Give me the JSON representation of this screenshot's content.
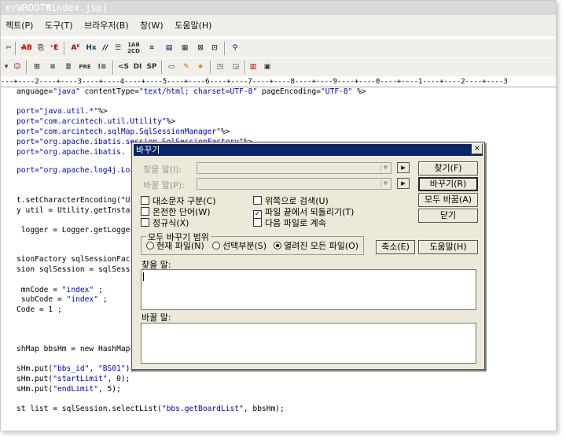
{
  "window": {
    "title": "erWROOT₩index.jsp]"
  },
  "menu": [
    "젝트(P)",
    "도구(T)",
    "브라우저(B)",
    "창(W)",
    "도움말(H)"
  ],
  "toolbar1": [
    "✂",
    "A̶B",
    "⎘",
    "⁺E",
    "A⁶",
    "Hx",
    "//",
    "☰",
    "1AB 2CD",
    "⌗",
    "▤",
    "▦",
    "⊠",
    "⊡",
    "⚲"
  ],
  "toolbar2": [
    "▾",
    "☺",
    "⊞",
    "≡",
    "≣",
    "PRE",
    "⁝≡",
    "<S",
    "DI",
    "SP",
    "▭",
    "✎",
    "★",
    "◳",
    "◲",
    "▥",
    "▣"
  ],
  "ruler": "---+----2----+----3----+----4----+----5----+----6----+----7----+----8----+----9----+----0----+----1----+----2----+----3",
  "code": {
    "l1": {
      "pre": "anguage=",
      "s1": "\"java\"",
      "m1": " contentType=",
      "s2": "\"text/html; charset=UTF-8\"",
      "m2": " pageEncoding=",
      "s3": "\"UTF-8\"",
      "end": " %>"
    },
    "l2": {
      "pre": "port=",
      "s": "\"java.util.*\"",
      "end": "%>"
    },
    "l3": {
      "pre": "port=",
      "s": "\"com.arcintech.util.Utility\"",
      "end": "%>"
    },
    "l4": {
      "pre": "port=",
      "s": "\"com.arcintech.sqlMap.SqlSessionManager\"",
      "end": "%>"
    },
    "l5": {
      "pre": "port=",
      "s": "\"org.apache.ibatis.session.SqlSessionFactory\"",
      "end": "%>"
    },
    "l6": {
      "pre": "port=",
      "s": "\"org.apache.ibatis.",
      "end": ""
    },
    "l7": {
      "pre": "port=",
      "s": "\"org.apache.log4j.Lo",
      "end": ""
    },
    "l8": "t.setCharacterEncoding(\"U",
    "l9": "y util = Utility.getInsta",
    "l10": " logger = Logger.getLogge",
    "l11": "sionFactory sqlSessionFac",
    "l12": "sion sqlSession = sqlSess",
    "l13": {
      "pre": " mnCode = ",
      "s": "\"index\"",
      "end": " ;"
    },
    "l14": {
      "pre": " subCode = ",
      "s": "\"index\"",
      "end": " ;"
    },
    "l15": "Code = 1 ;",
    "l16": "shMap bbsHm = new HashMap",
    "l17": {
      "pre": "sHm.put(",
      "s1": "\"bbs_id\"",
      "m": ", ",
      "s2": "\"BS01\"",
      "end": ");"
    },
    "l18": {
      "pre": "sHm.put(",
      "s1": "\"startLimit\"",
      "end": ", 0);"
    },
    "l19": {
      "pre": "sHm.put(",
      "s1": "\"endLimit\"",
      "end": ", 5);"
    },
    "l20": {
      "pre": "st list = sqlSession.selectList(",
      "s": "\"bbs.getBoardList\"",
      "end": ", bbsHm);"
    }
  },
  "dialog": {
    "title": "바꾸기",
    "close": "×",
    "find_label": "찾을 말(I):",
    "replace_label": "바꿀 말(P):",
    "buttons": {
      "find": "찾기(F)",
      "replace": "바꾸기(R)",
      "replace_all": "모두 바꿈(A)",
      "close": "닫기",
      "collapse": "축소(E)",
      "help": "도움말(H)"
    },
    "checks": {
      "match_case": {
        "label": "대소문자 구분(C)",
        "checked": false
      },
      "whole_word": {
        "label": "온전한 단어(W)",
        "checked": false
      },
      "regex": {
        "label": "정규식(X)",
        "checked": false
      },
      "search_up": {
        "label": "위쪽으로 검색(U)",
        "checked": false
      },
      "wrap": {
        "label": "파일 끝에서 되돌리기(T)",
        "checked": true
      },
      "next_file": {
        "label": "다음 파일로 계속",
        "checked": false
      }
    },
    "scope_label": "모두 바꾸기 범위",
    "scope": {
      "current": "현재 파일(N)",
      "selection": "선택부분(S)",
      "all_open": "열려진 모든 파일(O)",
      "selected": "all_open"
    },
    "find_area_label": "찾을 말:",
    "replace_area_label": "바꿀 말:"
  }
}
